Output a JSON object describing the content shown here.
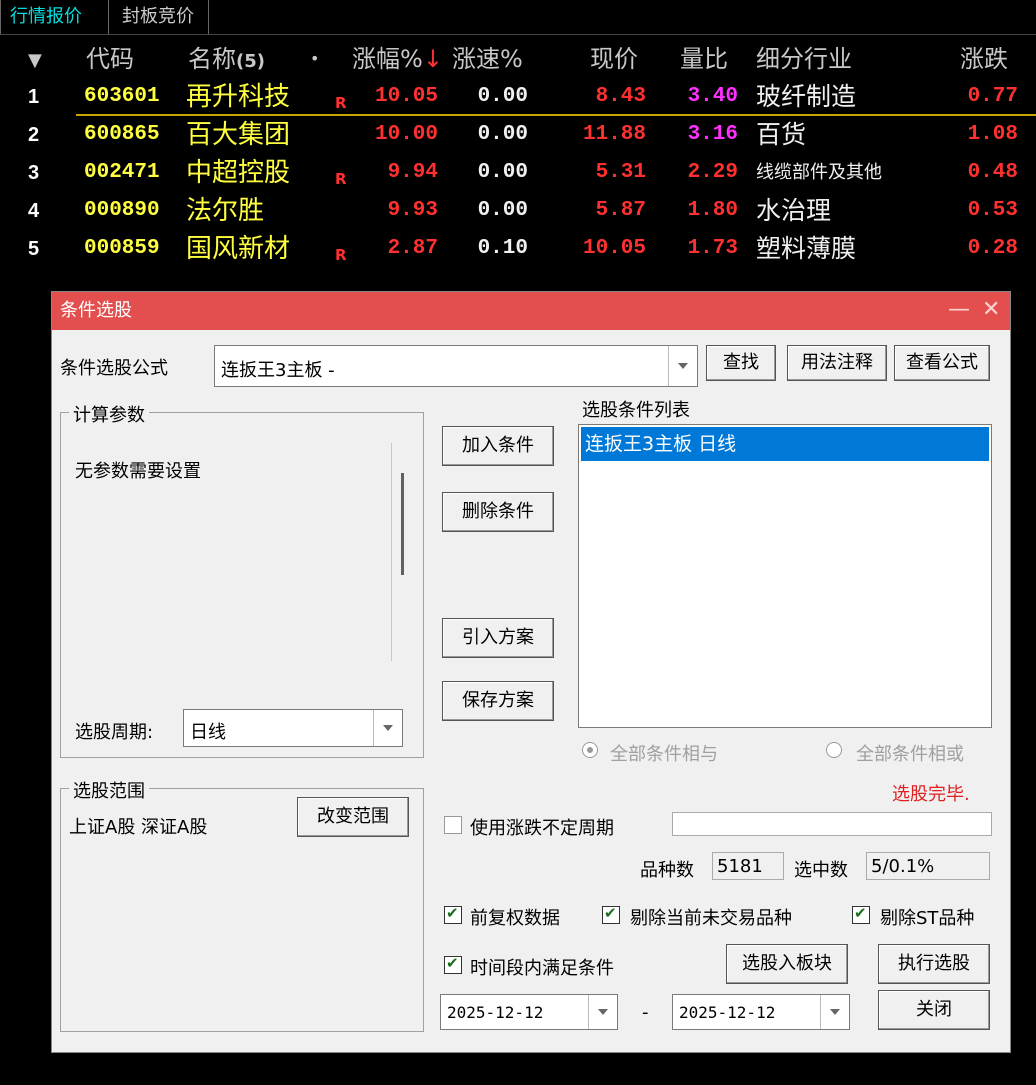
{
  "tabs": [
    "行情报价",
    "封板竞价"
  ],
  "table": {
    "headers": {
      "sort_icon": "▼",
      "code": "代码",
      "name": "名称",
      "name_count": "(5)",
      "dot": "•",
      "change": "涨幅%",
      "change_sort": "↓",
      "speed": "涨速%",
      "price": "现价",
      "vol_ratio": "量比",
      "industry": "细分行业",
      "updown": "涨跌"
    },
    "rows": [
      {
        "idx": "1",
        "code": "603601",
        "name": "再升科技",
        "flag": "R",
        "change": "10.05",
        "speed": "0.00",
        "price": "8.43",
        "vol_ratio": "3.40",
        "industry": "玻纤制造",
        "updown": "0.77"
      },
      {
        "idx": "2",
        "code": "600865",
        "name": "百大集团",
        "flag": "",
        "change": "10.00",
        "speed": "0.00",
        "price": "11.88",
        "vol_ratio": "3.16",
        "industry": "百货",
        "updown": "1.08"
      },
      {
        "idx": "3",
        "code": "002471",
        "name": "中超控股",
        "flag": "R",
        "change": "9.94",
        "speed": "0.00",
        "price": "5.31",
        "vol_ratio": "2.29",
        "industry": "线缆部件及其他",
        "updown": "0.48"
      },
      {
        "idx": "4",
        "code": "000890",
        "name": "法尔胜",
        "flag": "",
        "change": "9.93",
        "speed": "0.00",
        "price": "5.87",
        "vol_ratio": "1.80",
        "industry": "水治理",
        "updown": "0.53"
      },
      {
        "idx": "5",
        "code": "000859",
        "name": "国风新材",
        "flag": "R",
        "change": "2.87",
        "speed": "0.10",
        "price": "10.05",
        "vol_ratio": "1.73",
        "industry": "塑料薄膜",
        "updown": "0.28"
      }
    ]
  },
  "dialog": {
    "title": "条件选股",
    "minimize": "—",
    "close": "✕",
    "formula_label": "条件选股公式",
    "formula_value": "连扳王3主板  -",
    "find_btn": "查找",
    "usage_btn": "用法注释",
    "view_formula_btn": "查看公式",
    "calc_params_label": "计算参数",
    "no_params": "无参数需要设置",
    "period_label": "选股周期:",
    "period_value": "日线",
    "add_cond_btn": "加入条件",
    "del_cond_btn": "删除条件",
    "import_plan_btn": "引入方案",
    "save_plan_btn": "保存方案",
    "cond_list_label": "选股条件列表",
    "cond_list": [
      "连扳王3主板  日线"
    ],
    "radio_and": "全部条件相与",
    "radio_or": "全部条件相或",
    "status": "选股完毕.",
    "range_label": "选股范围",
    "range_value": "上证A股 深证A股",
    "change_range_btn": "改变范围",
    "use_uncertain_period": "使用涨跌不定周期",
    "count_label": "品种数",
    "count_value": "5181",
    "selected_label": "选中数",
    "selected_value": "5/0.1%",
    "pre_adjust": "前复权数据",
    "exclude_untraded": "剔除当前未交易品种",
    "exclude_st": "剔除ST品种",
    "time_range_cond": "时间段内满足条件",
    "to_block_btn": "选股入板块",
    "run_btn": "执行选股",
    "date_from": "2025-12-12",
    "date_sep": "-",
    "date_to": "2025-12-12",
    "close_btn": "关闭"
  },
  "colors": {
    "up_red": "#ff3030",
    "code_yellow": "#ffff40",
    "vol_magenta": "#ff30ff",
    "title_red": "#e34f4f",
    "select_blue": "#0078d7"
  }
}
